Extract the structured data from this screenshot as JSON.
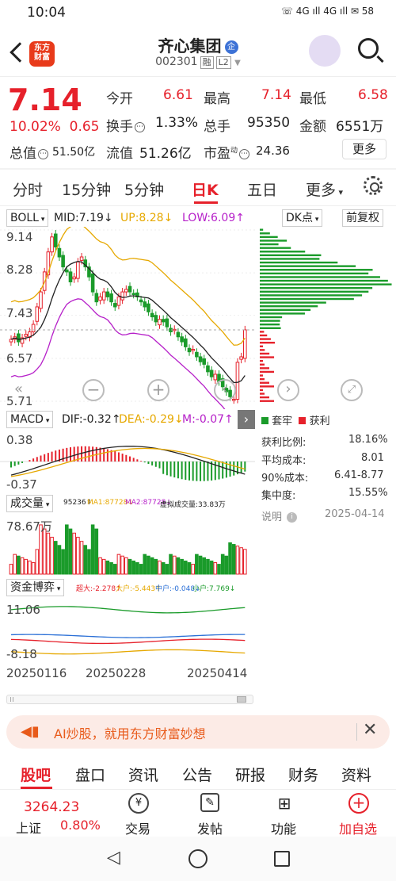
{
  "status": {
    "time": "10:04",
    "indicators": "☏ 4G ıll 4G ıll ✉ 58"
  },
  "header": {
    "logo_text_1": "东方",
    "logo_text_2": "财富",
    "title": "齐心集团",
    "title_badge": "企",
    "code": "002301",
    "tag1": "融",
    "tag2": "L2"
  },
  "quote": {
    "price": "7.14",
    "pct": "10.02%",
    "chg": "0.65",
    "open_label": "今开",
    "open": "6.61",
    "high_label": "最高",
    "high": "7.14",
    "low_label": "最低",
    "low": "6.58",
    "turnover_label": "换手",
    "turnover": "1.33%",
    "volume_label": "总手",
    "volume": "95350",
    "amount_label": "金额",
    "amount": "6551万",
    "mktcap_label": "总值",
    "mktcap": "51.50亿",
    "float_label": "流值",
    "float": "51.26亿",
    "pe_label": "市盈",
    "pe_sup": "动",
    "pe": "24.36",
    "more": "更多"
  },
  "tabs": [
    "分时",
    "15分钟",
    "5分钟",
    "日K",
    "五日",
    "更多"
  ],
  "chart": {
    "boll_label": "BOLL",
    "mid": "MID:7.19↓",
    "up": "UP:8.28↓",
    "low": "LOW:6.09↑",
    "dk_btn": "DK点",
    "adjust_btn": "前复权",
    "y_labels": [
      "9.14",
      "8.28",
      "7.43",
      "6.57",
      "5.71"
    ],
    "macd_label": "MACD",
    "dif": "DIF:-0.32↑",
    "dea": "DEA:-0.29↓",
    "m": "M:-0.07↑",
    "macd_y": [
      "0.38",
      "-0.37"
    ],
    "vol_label": "成交量",
    "vol_vals": "95236↑",
    "vol_ma1": "MA1:87728↓",
    "vol_ma2": "MA2:87728↓",
    "vol_virtual": "虚拟成交量:33.83万",
    "vol_y": "78.67万",
    "fund_label": "资金博弈",
    "fund_super": "超大:-2.278↑",
    "fund_big": "大户:-5.443↑",
    "fund_mid": "中户:-0.048↓",
    "fund_small": "小户:7.769↓",
    "fund_y": [
      "11.06",
      "-8.18"
    ],
    "dates": [
      "20250116",
      "20250228",
      "20250414"
    ]
  },
  "chart_data": {
    "type": "candlestick",
    "boll": {
      "mid": 7.19,
      "up": 8.28,
      "low": 6.09
    },
    "macd": {
      "dif": -0.32,
      "dea": -0.29,
      "m": -0.07
    },
    "volume": {
      "last": 95236,
      "ma1": 87728,
      "ma2": 87728
    },
    "fund": {
      "super": -2.278,
      "big": -5.443,
      "mid": -0.048,
      "small": 7.769
    },
    "dates": [
      "20250116",
      "20250228",
      "20250414"
    ]
  },
  "chip_panel": {
    "legend_trapped": "套牢",
    "legend_profit": "获利",
    "rows": [
      {
        "label": "获利比例:",
        "value": "18.16%"
      },
      {
        "label": "平均成本:",
        "value": "8.01"
      },
      {
        "label": "90%成本:",
        "value": "6.41-8.77"
      },
      {
        "label": "集中度:",
        "value": "15.55%"
      }
    ],
    "note": "说明",
    "date": "2025-04-14"
  },
  "banner": {
    "text": "AI炒股，就用东方财富妙想"
  },
  "bottom_tabs": [
    "股吧",
    "盘口",
    "资讯",
    "公告",
    "研报",
    "财务",
    "资料"
  ],
  "footer": {
    "index_value": "3264.23",
    "index_name": "上证",
    "index_pct": "0.80%",
    "trade": "交易",
    "post": "发帖",
    "func": "功能",
    "add": "加自选"
  },
  "colors": {
    "up": "#e6212b",
    "down": "#1a9b2a",
    "accent": "#e6212b"
  }
}
